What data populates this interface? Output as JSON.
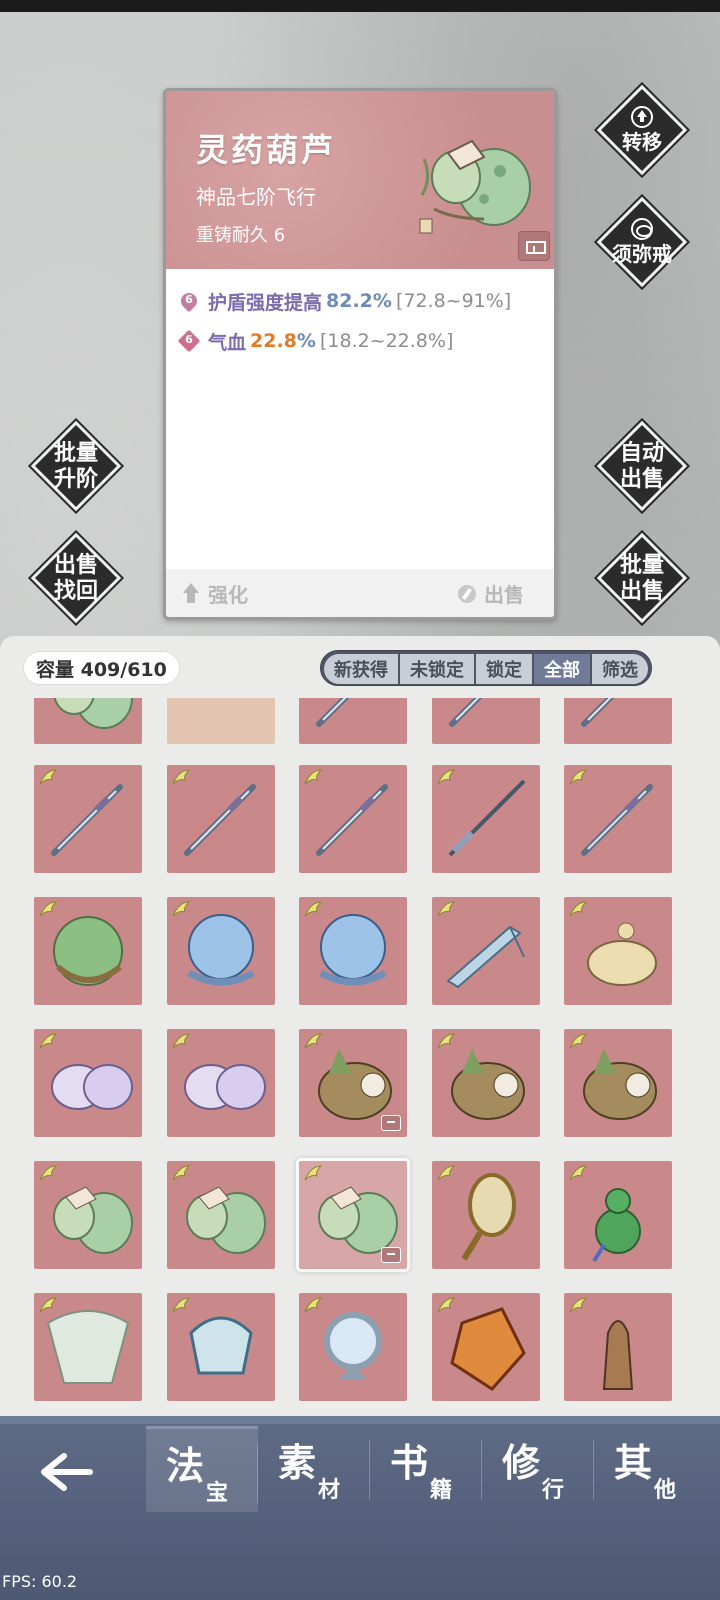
{
  "detail": {
    "name": "灵药葫芦",
    "grade": "神品七阶飞行",
    "durability": "重铸耐久 6",
    "stats": [
      {
        "badge": "6",
        "name": "护盾强度提高",
        "value": "82.2%",
        "range": "[72.8~91%]"
      },
      {
        "badge": "6",
        "name": "气血",
        "value": "22.8",
        "value_suffix": "%",
        "range": "[18.2~22.8%]"
      }
    ],
    "actions": {
      "enhance": "强化",
      "sell": "出售"
    }
  },
  "side_buttons": {
    "transfer": "转移",
    "ring": "须弥戒",
    "batch_upgrade_1": "批量",
    "batch_upgrade_2": "升阶",
    "recover_1": "出售",
    "recover_2": "找回",
    "auto_sell_1": "自动",
    "auto_sell_2": "出售",
    "batch_sell_1": "批量",
    "batch_sell_2": "出售"
  },
  "bag": {
    "capacity": "容量 409/610",
    "filters": [
      "新获得",
      "未锁定",
      "锁定",
      "全部",
      "筛选"
    ],
    "active_filter": "全部"
  },
  "nav": {
    "tabs": [
      {
        "big": "法",
        "small": "宝"
      },
      {
        "big": "素",
        "small": "材"
      },
      {
        "big": "书",
        "small": "籍"
      },
      {
        "big": "修",
        "small": "行"
      },
      {
        "big": "其",
        "small": "他"
      }
    ]
  },
  "fps": "FPS: 60.2",
  "colors": {
    "card_header": "#c98f90",
    "stat_name": "#7c6bae",
    "stat_value": "#6d8bb5",
    "stat_value_highlight": "#e07b2a",
    "nav_bg": "#56627d",
    "filter_active": "#6f7b97"
  }
}
